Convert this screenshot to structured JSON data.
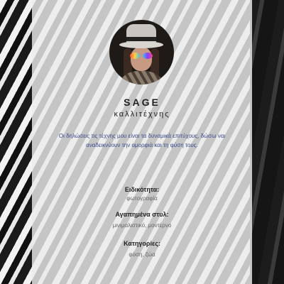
{
  "profile": {
    "name": "SAGE",
    "role": "καλλιτέχνης",
    "description": "Οι δηλώσεις τις τέχνης μου είναι τα δυναμικά επιτύχους, δώσω ναι αναδεικνύουν την ομορφιά και τη φύση τους."
  },
  "details": [
    {
      "label": "Ειδικότητα:",
      "value": "φωτογραφία"
    },
    {
      "label": "Αγαπημένα στυλ:",
      "value": "μινιμαλιστικό, μοντέρνο"
    },
    {
      "label": "Κατηγορίες:",
      "value": "φύση, ζώα"
    }
  ]
}
